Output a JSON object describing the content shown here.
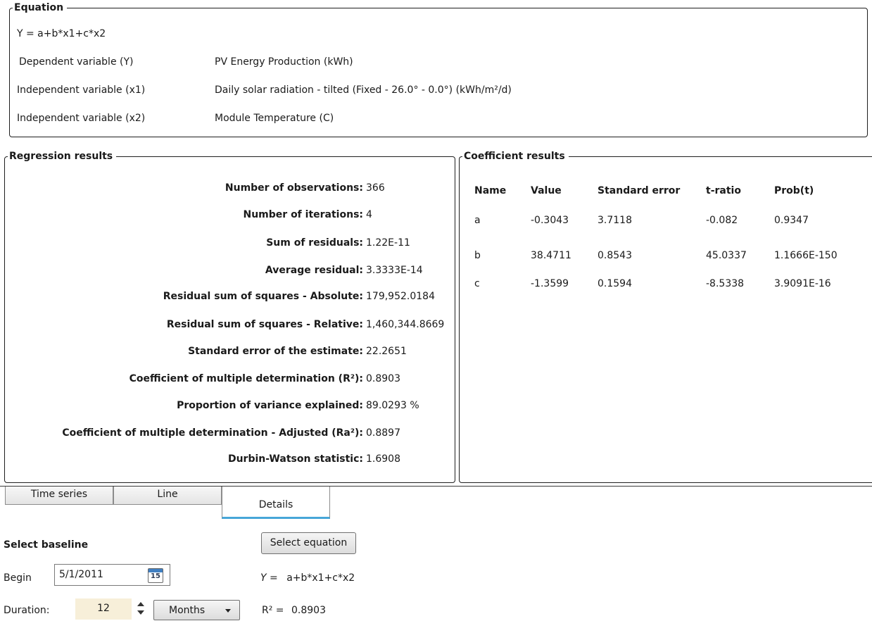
{
  "equation_group": {
    "title": "Equation",
    "formula": "Y = a+b*x1+c*x2",
    "rows": [
      {
        "label": "Dependent variable (Y)",
        "value": "PV Energy Production (kWh)"
      },
      {
        "label": "Independent variable (x1)",
        "value": "Daily solar radiation - tilted (Fixed - 26.0° - 0.0°) (kWh/m²/d)"
      },
      {
        "label": "Independent variable (x2)",
        "value": "Module Temperature (C)"
      }
    ]
  },
  "regression": {
    "title": "Regression results",
    "rows": [
      {
        "label": "Number of observations:",
        "value": "366"
      },
      {
        "label": "Number of iterations:",
        "value": "4"
      },
      {
        "label": "Sum of residuals:",
        "value": "1.22E-11"
      },
      {
        "label": "Average residual:",
        "value": "3.3333E-14"
      },
      {
        "label": "Residual sum of squares - Absolute:",
        "value": "179,952.0184"
      },
      {
        "label": "Residual sum of squares - Relative:",
        "value": "1,460,344.8669"
      },
      {
        "label": "Standard error of the estimate:",
        "value": "22.2651"
      },
      {
        "label": "Coefficient of multiple determination (R²):",
        "value": "0.8903"
      },
      {
        "label": "Proportion of variance explained:",
        "value": "89.0293 %"
      },
      {
        "label": "Coefficient of multiple determination - Adjusted (Ra²):",
        "value": "0.8897"
      },
      {
        "label": "Durbin-Watson statistic:",
        "value": "1.6908"
      }
    ]
  },
  "coefficients": {
    "title": "Coefficient results",
    "headers": [
      "Name",
      "Value",
      "Standard error",
      "t-ratio",
      "Prob(t)"
    ],
    "rows": [
      [
        "a",
        "-0.3043",
        "3.7118",
        "-0.082",
        "0.9347"
      ],
      [
        "b",
        "38.4711",
        "0.8543",
        "45.0337",
        "1.1666E-150"
      ],
      [
        "c",
        "-1.3599",
        "0.1594",
        "-8.5338",
        "3.9091E-16"
      ]
    ]
  },
  "tabs": [
    {
      "label": "Time series"
    },
    {
      "label": "Line"
    },
    {
      "label": "Details"
    }
  ],
  "baseline": {
    "title": "Select baseline",
    "select_equation_label": "Select equation",
    "begin_label": "Begin",
    "begin_value": "5/1/2011",
    "calendar_day": "15",
    "duration_label": "Duration:",
    "duration_value": "12",
    "duration_unit": "Months",
    "y_label": "Y =",
    "y_formula": "a+b*x1+c*x2",
    "r2_label": "R² =",
    "r2_value": "0.8903"
  },
  "colors": {
    "tab_active_accent": "#47a6d8",
    "duration_bg": "#f7efd9",
    "calendar_blue": "#3f7fc2"
  }
}
